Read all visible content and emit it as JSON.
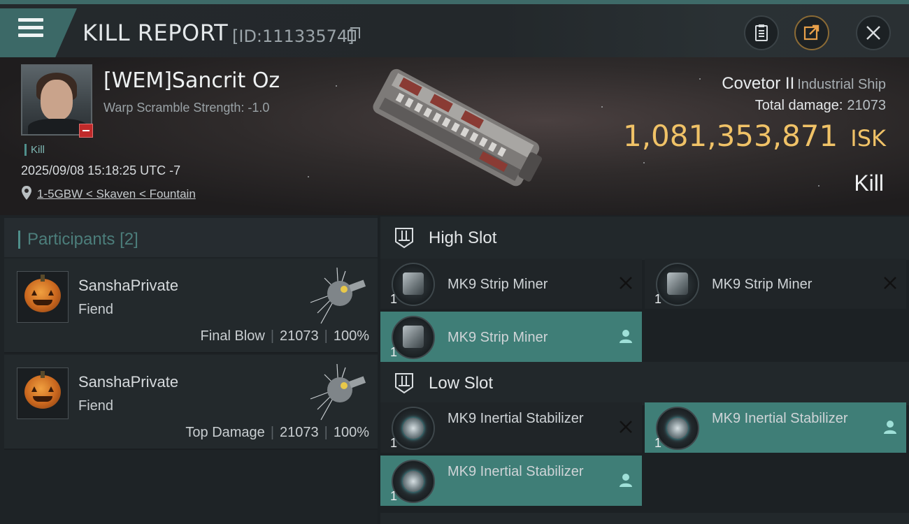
{
  "header": {
    "title": "KILL REPORT",
    "report_id": "[ID:11133574]"
  },
  "victim": {
    "pilot_name": "[WEM]Sancrit Oz",
    "warp_scramble": "Warp Scramble Strength: -1.0",
    "kill_tag": "Kill",
    "datetime": "2025/09/08 15:18:25 UTC -7",
    "location": "1-5GBW < Skaven < Fountain",
    "ship_name": "Covetor II",
    "ship_class": "Industrial Ship",
    "total_damage_label": "Total damage:",
    "total_damage": "21073",
    "isk_value": "1,081,353,871",
    "isk_unit": "ISK",
    "result": "Kill"
  },
  "participants": {
    "title": "Participants",
    "count": "[2]",
    "rows": [
      {
        "name": "SanshaPrivate",
        "ship": "Fiend",
        "role": "Final Blow",
        "damage": "21073",
        "percent": "100%"
      },
      {
        "name": "SanshaPrivate",
        "ship": "Fiend",
        "role": "Top Damage",
        "damage": "21073",
        "percent": "100%"
      }
    ]
  },
  "fitting": {
    "high_slot": {
      "title": "High Slot",
      "modules": [
        {
          "qty": "1",
          "name": "MK9 Strip Miner",
          "status": "destroyed"
        },
        {
          "qty": "1",
          "name": "MK9 Strip Miner",
          "status": "destroyed"
        },
        {
          "qty": "1",
          "name": "MK9 Strip Miner",
          "status": "dropped"
        }
      ]
    },
    "low_slot": {
      "title": "Low Slot",
      "modules": [
        {
          "qty": "1",
          "name": "MK9 Inertial Stabilizer",
          "status": "destroyed"
        },
        {
          "qty": "1",
          "name": "MK9 Inertial Stabilizer",
          "status": "dropped"
        },
        {
          "qty": "1",
          "name": "MK9 Inertial Stabilizer",
          "status": "dropped"
        }
      ]
    }
  },
  "colors": {
    "accent_teal": "#3f7e77",
    "isk_gold": "#f0c267",
    "danger_red": "#c02a2a"
  }
}
